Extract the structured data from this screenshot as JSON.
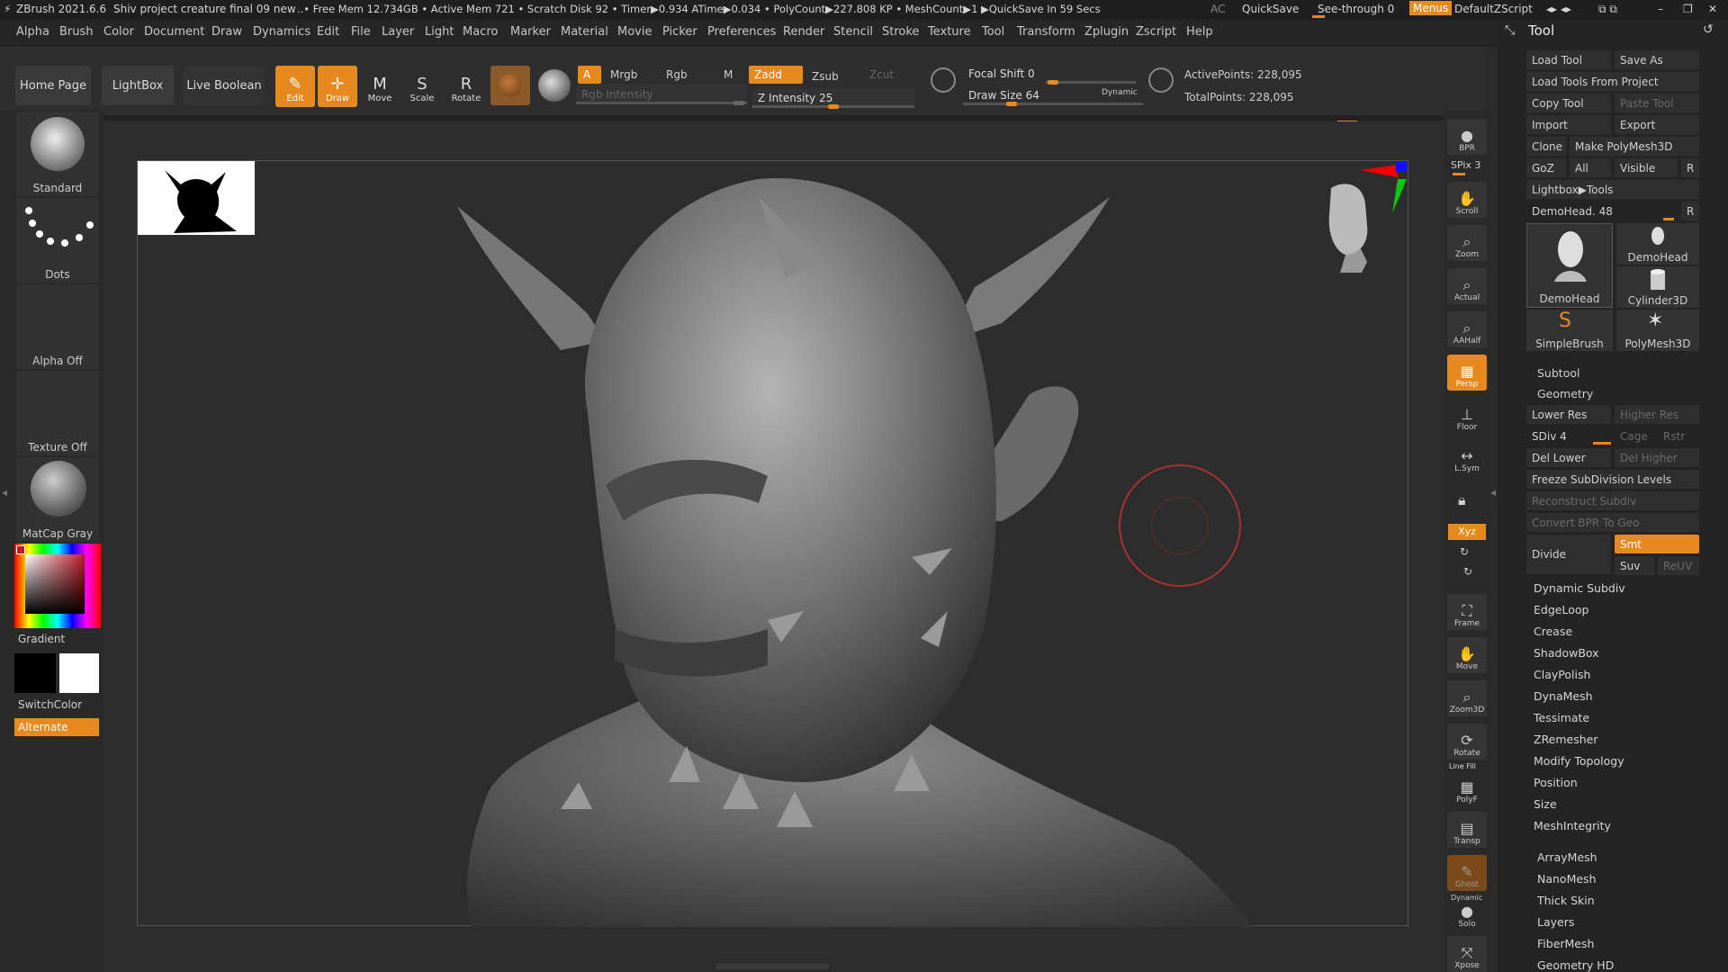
{
  "titlebar": {
    "app": "ZBrush 2021.6.6",
    "project": "Shiv project creature final 09 new",
    "stats": "..• Free Mem 12.734GB • Active Mem 721 • Scratch Disk 92 • Timer▶0.934 ATime▶0.034 • PolyCount▶227.808 KP • MeshCount▶1 ▶QuickSave In 59 Secs",
    "ac": "AC",
    "quicksave": "QuickSave",
    "see_through": "See-through  0",
    "menus": "Menus",
    "script": "DefaultZScript"
  },
  "menubar": [
    "Alpha",
    "Brush",
    "Color",
    "Document",
    "Draw",
    "Dynamics",
    "Edit",
    "File",
    "Layer",
    "Light",
    "Macro",
    "Marker",
    "Material",
    "Movie",
    "Picker",
    "Preferences",
    "Render",
    "Stencil",
    "Stroke",
    "Texture",
    "Tool",
    "Transform",
    "Zplugin",
    "Zscript",
    "Help"
  ],
  "shelf": {
    "home": "Home Page",
    "lightbox": "LightBox",
    "live_boolean": "Live Boolean",
    "tools": [
      {
        "label": "Edit",
        "icon": "edit-icon",
        "glyph": "✎",
        "on": true
      },
      {
        "label": "Draw",
        "icon": "draw-icon",
        "glyph": "✛",
        "on": true
      },
      {
        "label": "Move",
        "icon": "move-icon",
        "glyph": "M",
        "on": false
      },
      {
        "label": "Scale",
        "icon": "scale-icon",
        "glyph": "S",
        "on": false
      },
      {
        "label": "Rotate",
        "icon": "rotate-icon",
        "glyph": "R",
        "on": false
      }
    ],
    "a": "A",
    "mrgb": "Mrgb",
    "rgb": "Rgb",
    "m": "M",
    "zadd": "Zadd",
    "zsub": "Zsub",
    "zcut": "Zcut",
    "rgb_intensity": "Rgb Intensity",
    "z_intensity": "Z Intensity 25",
    "focal_shift": "Focal Shift 0",
    "draw_size": "Draw Size 64",
    "dynamic": "Dynamic",
    "active_points": "ActivePoints: 228,095",
    "total_points": "TotalPoints: 228,095"
  },
  "left": {
    "brush": "Standard",
    "stroke": "Dots",
    "alpha": "Alpha Off",
    "texture": "Texture Off",
    "material": "MatCap Gray",
    "gradient": "Gradient",
    "switch_color": "SwitchColor",
    "alternate": "Alternate"
  },
  "right_shelf": [
    {
      "label": "BPR",
      "icon": "bpr-icon"
    },
    {
      "label": "Scroll",
      "icon": "scroll-icon"
    },
    {
      "label": "Zoom",
      "icon": "zoom-icon"
    },
    {
      "label": "Actual",
      "icon": "actual-icon"
    },
    {
      "label": "AAHalf",
      "icon": "aahalf-icon"
    },
    {
      "label": "Persp",
      "icon": "persp-icon"
    },
    {
      "label": "Floor",
      "icon": "floor-icon"
    },
    {
      "label": "L.Sym",
      "icon": "lsym-icon"
    },
    {
      "label": "Frame",
      "icon": "frame-icon"
    },
    {
      "label": "Move",
      "icon": "move-view-icon"
    },
    {
      "label": "Zoom3D",
      "icon": "zoom3d-icon"
    },
    {
      "label": "Rotate",
      "icon": "rotate-view-icon"
    },
    {
      "label": "PolyF",
      "icon": "polyf-icon"
    },
    {
      "label": "Transp",
      "icon": "transp-icon"
    },
    {
      "label": "Ghost",
      "icon": "ghost-icon"
    },
    {
      "label": "Solo",
      "icon": "solo-icon"
    },
    {
      "label": "Xpose",
      "icon": "xpose-icon"
    }
  ],
  "right_misc": {
    "spix": "SPix 3",
    "xyz": "Xyz",
    "line_fill": "Line Fill",
    "dynamic": "Dynamic"
  },
  "toolpanel": {
    "title": "Tool",
    "load_tool": "Load Tool",
    "save_as": "Save As",
    "load_from_project": "Load Tools From Project",
    "copy_tool": "Copy Tool",
    "paste_tool": "Paste Tool",
    "import": "Import",
    "export": "Export",
    "clone": "Clone",
    "make_polymesh": "Make PolyMesh3D",
    "goz": "GoZ",
    "all": "All",
    "visible": "Visible",
    "r": "R",
    "lightbox_tools": "Lightbox▶Tools",
    "demohead_slider": "DemoHead. 48",
    "thumbs": [
      "DemoHead",
      "DemoHead",
      "Cylinder3D",
      "SimpleBrush",
      "PolyMesh3D"
    ],
    "subtool": "Subtool",
    "geometry": "Geometry",
    "lower_res": "Lower Res",
    "higher_res": "Higher Res",
    "sdiv": "SDiv 4",
    "cage": "Cage",
    "rstr": "Rstr",
    "del_lower": "Del Lower",
    "del_higher": "Del Higher",
    "freeze": "Freeze SubDivision Levels",
    "reconstruct": "Reconstruct Subdiv",
    "convert_bpr": "Convert BPR To Geo",
    "divide": "Divide",
    "smt": "Smt",
    "suv": "Suv",
    "reuv": "ReUV",
    "geometry_items": [
      "Dynamic Subdiv",
      "EdgeLoop",
      "Crease",
      "ShadowBox",
      "ClayPolish",
      "DynaMesh",
      "Tessimate",
      "ZRemesher",
      "Modify Topology",
      "Position",
      "Size",
      "MeshIntegrity"
    ],
    "more_items": [
      "ArrayMesh",
      "NanoMesh",
      "Thick Skin",
      "Layers",
      "FiberMesh",
      "Geometry HD"
    ]
  }
}
